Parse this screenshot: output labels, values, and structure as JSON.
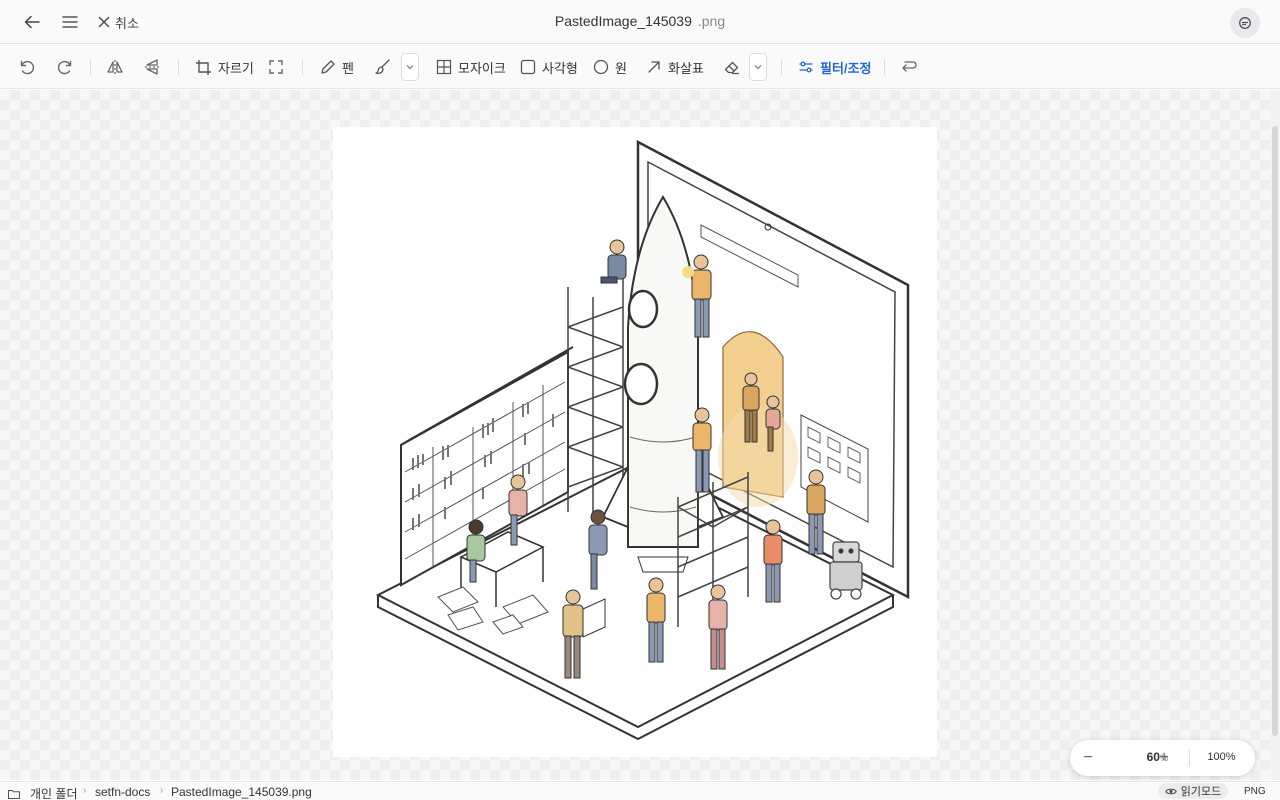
{
  "titlebar": {
    "cancel_label": "취소",
    "filename": "PastedImage_145039",
    "extension": ".png"
  },
  "toolbar": {
    "crop_label": "자르기",
    "pen_label": "펜",
    "mosaic_label": "모자이크",
    "rect_label": "사각형",
    "circle_label": "원",
    "arrow_label": "화살표",
    "filter_label": "필터/조정"
  },
  "zoom": {
    "value": "60",
    "unit": "%",
    "fit_label": "100%"
  },
  "statusbar": {
    "breadcrumbs": [
      "개인 폴더",
      "setfn-docs",
      "PastedImage_145039.png"
    ],
    "read_mode_label": "읽기모드",
    "format": "PNG"
  },
  "colors": {
    "accent": "#2266d6",
    "illustration_warm": "#e9b66a"
  },
  "icons": [
    "back-arrow-icon",
    "hamburger-menu-icon",
    "close-icon",
    "chat-icon",
    "undo-icon",
    "redo-icon",
    "flip-horizontal-icon",
    "flip-vertical-icon",
    "crop-icon",
    "fullscreen-icon",
    "pen-icon",
    "brush-icon",
    "chevron-down-icon",
    "mosaic-icon",
    "square-icon",
    "circle-icon",
    "arrow-icon",
    "eraser-icon",
    "sliders-icon",
    "return-icon",
    "folder-icon",
    "eye-icon"
  ]
}
